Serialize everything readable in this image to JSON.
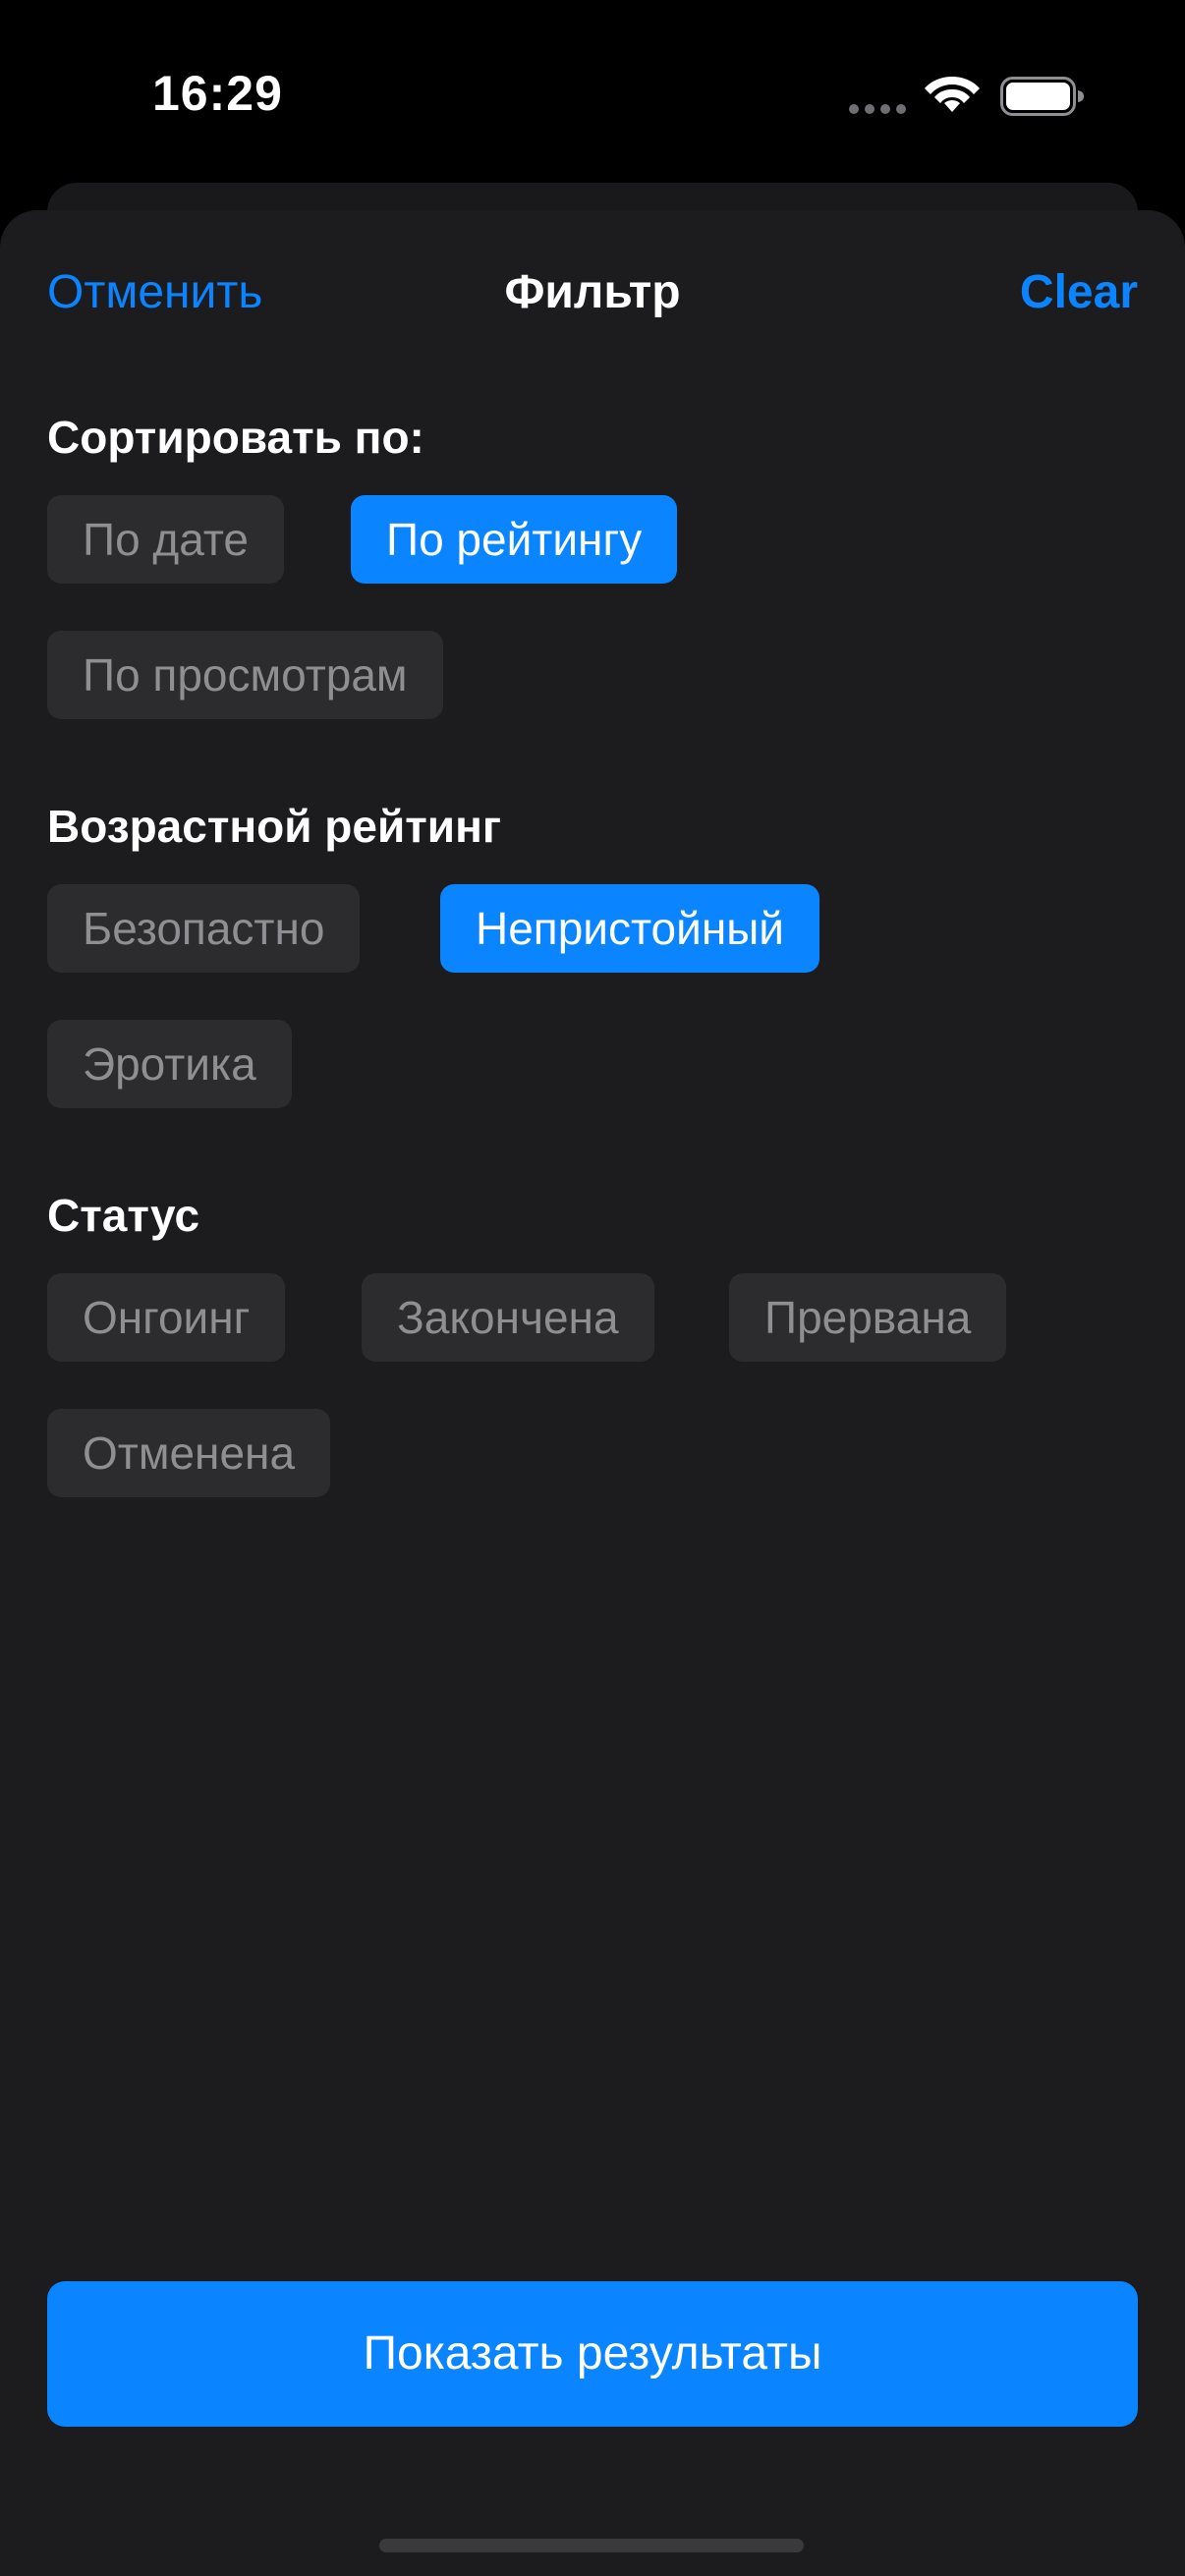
{
  "status_bar": {
    "time": "16:29",
    "icons": [
      "signal-dots-icon",
      "wifi-icon",
      "battery-icon"
    ]
  },
  "colors": {
    "accent": "#0a84ff",
    "sheet_background": "#1c1c1e",
    "chip_background": "#2c2c2e",
    "chip_text": "#8e8e93"
  },
  "nav": {
    "cancel_label": "Отменить",
    "title": "Фильтр",
    "clear_label": "Clear"
  },
  "sort": {
    "title": "Сортировать по:",
    "options": [
      {
        "label": "По дате",
        "selected": false
      },
      {
        "label": "По рейтингу",
        "selected": true
      },
      {
        "label": "По просмотрам",
        "selected": false
      }
    ]
  },
  "age_rating": {
    "title": "Возрастной рейтинг",
    "options": [
      {
        "label": "Безопастно",
        "selected": false
      },
      {
        "label": "Непристойный",
        "selected": true
      },
      {
        "label": "Эротика",
        "selected": false
      }
    ]
  },
  "status": {
    "title": "Статус",
    "options": [
      {
        "label": "Онгоинг",
        "selected": false
      },
      {
        "label": "Закончена",
        "selected": false
      },
      {
        "label": "Прервана",
        "selected": false
      },
      {
        "label": "Отменена",
        "selected": false
      }
    ]
  },
  "footer": {
    "show_results_label": "Показать результаты"
  }
}
